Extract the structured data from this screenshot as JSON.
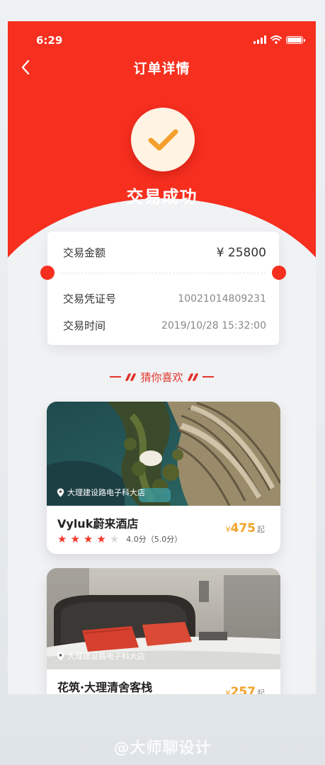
{
  "status_bar": {
    "time": "6:29"
  },
  "nav": {
    "title": "订单详情"
  },
  "hero": {
    "status_text": "交易成功"
  },
  "ticket": {
    "amount_label": "交易金额",
    "amount_value": "¥ 25800",
    "voucher_label": "交易凭证号",
    "voucher_value": "10021014809231",
    "time_label": "交易时间",
    "time_value": "2019/10/28 15:32:00"
  },
  "recommend": {
    "title": "猜你喜欢",
    "cards": [
      {
        "location": "大理建设路电子科大店",
        "name": "Vyluk蔚来酒店",
        "price_symbol": "¥",
        "price": "475",
        "price_unit": "起",
        "rating_stars": 4,
        "rating_text": "4.0分（5.0分）"
      },
      {
        "location": "大理建设路电子科大店",
        "name": "花筑·大理清舍客栈",
        "price_symbol": "¥",
        "price": "257",
        "price_unit": "起"
      }
    ]
  },
  "watermark": "@大师聊设计",
  "colors": {
    "brand_red": "#f62f1f",
    "price_orange": "#f2a22a",
    "check_orange": "#f5a02d"
  },
  "icons": [
    "back-arrow-icon",
    "check-icon",
    "location-pin-icon",
    "star-icon",
    "signal-icon",
    "wifi-icon",
    "battery-icon"
  ]
}
